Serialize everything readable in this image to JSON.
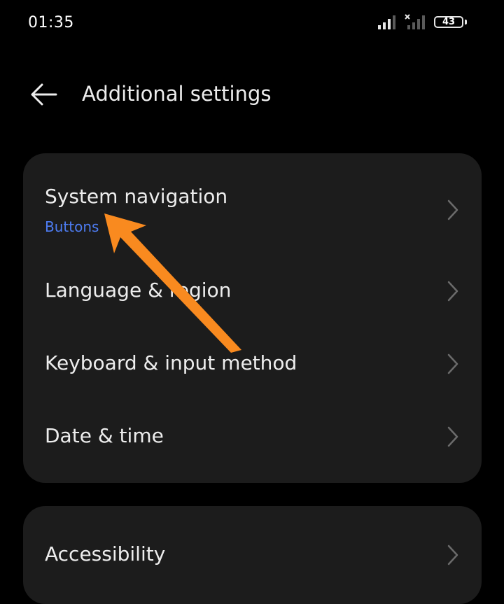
{
  "status_bar": {
    "time": "01:35",
    "battery_level": "43",
    "signal_icon": "cell-signal-icon",
    "no_signal_icon": "no-signal-icon"
  },
  "header": {
    "title": "Additional settings",
    "back_icon": "back-arrow-icon"
  },
  "settings_group_1": [
    {
      "title": "System navigation",
      "subtitle": "Buttons"
    },
    {
      "title": "Language & region"
    },
    {
      "title": "Keyboard & input method"
    },
    {
      "title": "Date & time"
    }
  ],
  "settings_group_2": [
    {
      "title": "Accessibility"
    }
  ],
  "colors": {
    "background": "#000000",
    "card": "#1c1c1c",
    "text": "#ededed",
    "subtitle_accent": "#4d7cf2",
    "chevron": "#6b6b6b",
    "annotation_arrow": "#f98a1f"
  },
  "annotation": {
    "type": "arrow",
    "icon": "annotation-arrow-icon"
  }
}
